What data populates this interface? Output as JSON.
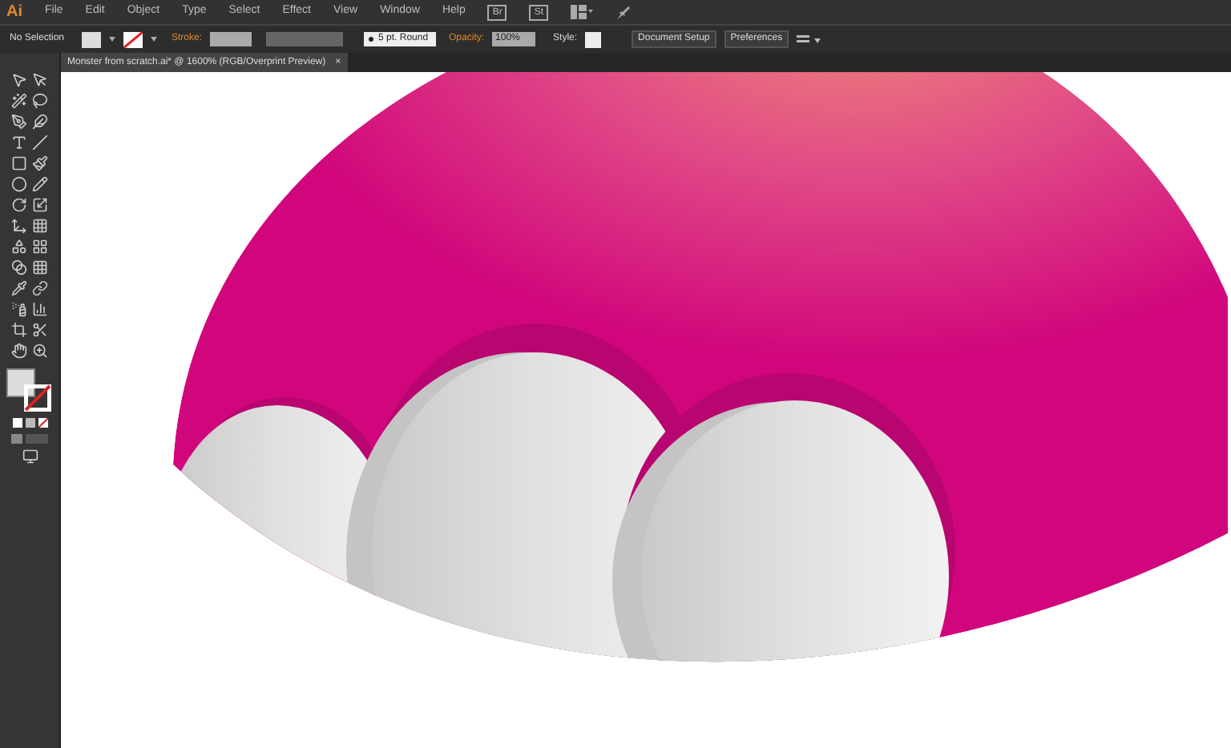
{
  "app_logo": "Ai",
  "menu": [
    "File",
    "Edit",
    "Object",
    "Type",
    "Select",
    "Effect",
    "View",
    "Window",
    "Help"
  ],
  "bridge_buttons": [
    "Br",
    "St"
  ],
  "control_bar": {
    "selection": "No Selection",
    "stroke_label": "Stroke:",
    "brush": "5 pt. Round",
    "opacity_label": "Opacity:",
    "opacity": "100%",
    "style_label": "Style:",
    "buttons": [
      "Document Setup",
      "Preferences"
    ]
  },
  "document_tab": {
    "title": "Monster from scratch.ai* @ 1600% (RGB/Overprint Preview)",
    "close": "×",
    "selected": true
  }
}
